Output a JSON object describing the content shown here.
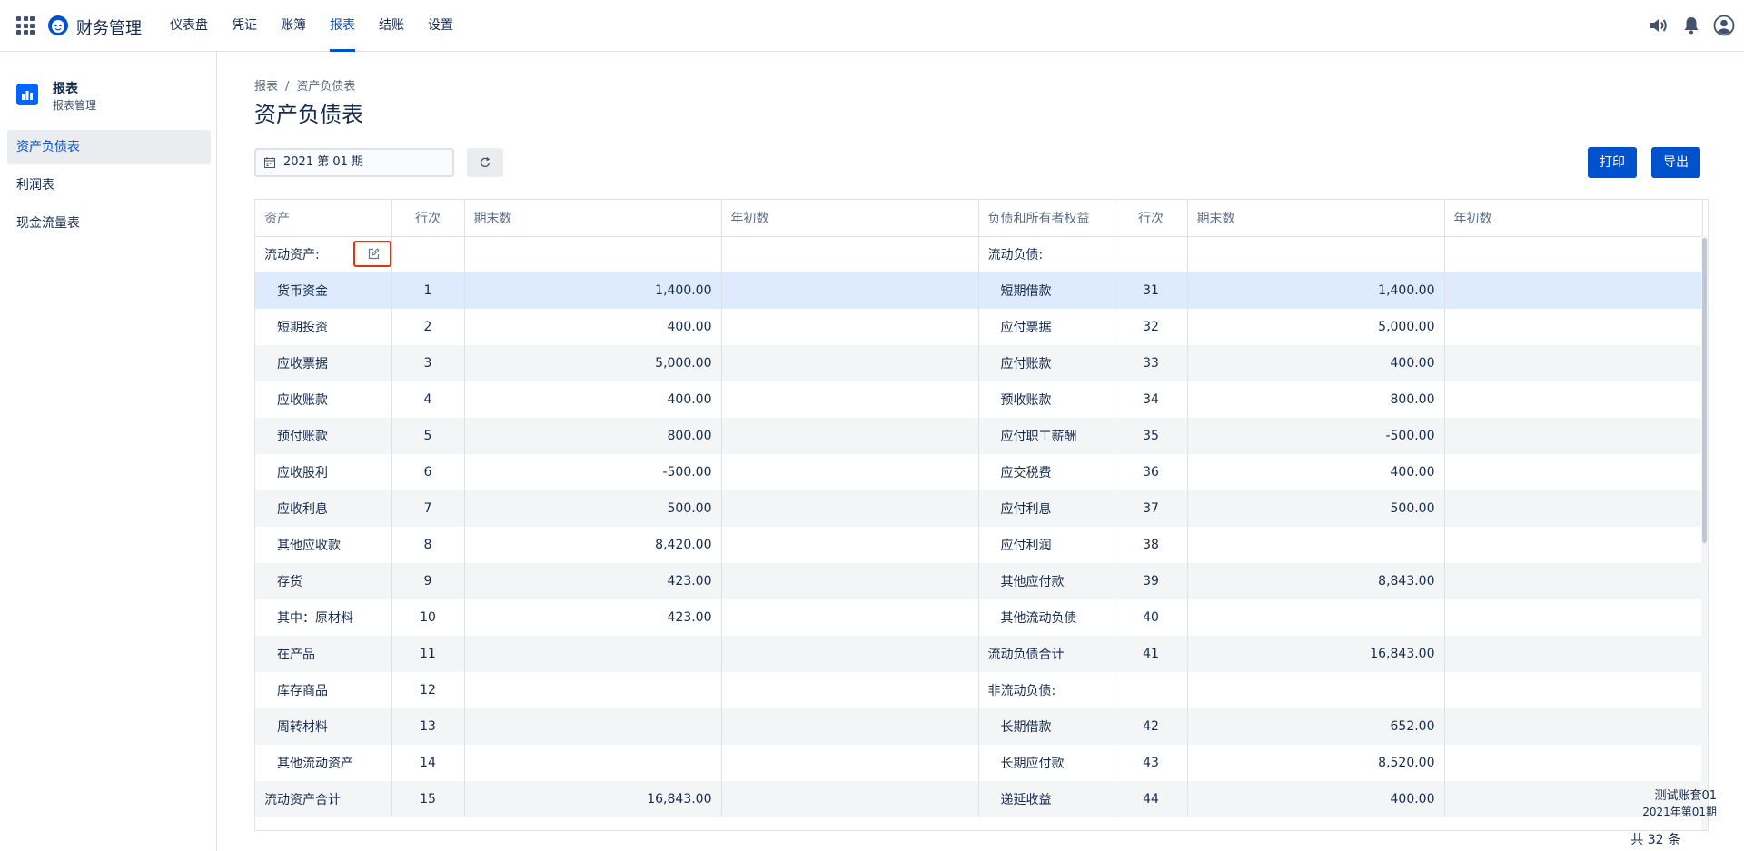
{
  "app": {
    "title": "财务管理"
  },
  "nav": {
    "items": [
      "仪表盘",
      "凭证",
      "账簿",
      "报表",
      "结账",
      "设置"
    ],
    "active_index": 3
  },
  "sidebar": {
    "title": "报表",
    "subtitle": "报表管理",
    "items": [
      "资产负债表",
      "利润表",
      "现金流量表"
    ],
    "active_index": 0
  },
  "breadcrumb": {
    "root": "报表",
    "separator": "/",
    "current": "资产负债表"
  },
  "page": {
    "title": "资产负债表"
  },
  "toolbar": {
    "period": "2021 第 01 期",
    "print_label": "打印",
    "export_label": "导出"
  },
  "table": {
    "headers": [
      "资产",
      "行次",
      "期末数",
      "年初数",
      "负债和所有者权益",
      "行次",
      "期末数",
      "年初数"
    ],
    "rows": [
      {
        "an": "流动资产:",
        "ar": "",
        "ae": "",
        "ab": "",
        "ln": "流动负债:",
        "lr": "",
        "le": "",
        "lb": "",
        "ai": false,
        "li": false
      },
      {
        "an": "货币资金",
        "ar": "1",
        "ae": "1,400.00",
        "ab": "",
        "ln": "短期借款",
        "lr": "31",
        "le": "1,400.00",
        "lb": "",
        "ai": true,
        "li": true
      },
      {
        "an": "短期投资",
        "ar": "2",
        "ae": "400.00",
        "ab": "",
        "ln": "应付票据",
        "lr": "32",
        "le": "5,000.00",
        "lb": "",
        "ai": true,
        "li": true
      },
      {
        "an": "应收票据",
        "ar": "3",
        "ae": "5,000.00",
        "ab": "",
        "ln": "应付账款",
        "lr": "33",
        "le": "400.00",
        "lb": "",
        "ai": true,
        "li": true
      },
      {
        "an": "应收账款",
        "ar": "4",
        "ae": "400.00",
        "ab": "",
        "ln": "预收账款",
        "lr": "34",
        "le": "800.00",
        "lb": "",
        "ai": true,
        "li": true
      },
      {
        "an": "预付账款",
        "ar": "5",
        "ae": "800.00",
        "ab": "",
        "ln": "应付职工薪酬",
        "lr": "35",
        "le": "-500.00",
        "lb": "",
        "ai": true,
        "li": true
      },
      {
        "an": "应收股利",
        "ar": "6",
        "ae": "-500.00",
        "ab": "",
        "ln": "应交税费",
        "lr": "36",
        "le": "400.00",
        "lb": "",
        "ai": true,
        "li": true
      },
      {
        "an": "应收利息",
        "ar": "7",
        "ae": "500.00",
        "ab": "",
        "ln": "应付利息",
        "lr": "37",
        "le": "500.00",
        "lb": "",
        "ai": true,
        "li": true
      },
      {
        "an": "其他应收款",
        "ar": "8",
        "ae": "8,420.00",
        "ab": "",
        "ln": "应付利润",
        "lr": "38",
        "le": "",
        "lb": "",
        "ai": true,
        "li": true
      },
      {
        "an": "存货",
        "ar": "9",
        "ae": "423.00",
        "ab": "",
        "ln": "其他应付款",
        "lr": "39",
        "le": "8,843.00",
        "lb": "",
        "ai": true,
        "li": true
      },
      {
        "an": "其中：原材料",
        "ar": "10",
        "ae": "423.00",
        "ab": "",
        "ln": "其他流动负债",
        "lr": "40",
        "le": "",
        "lb": "",
        "ai": true,
        "li": true
      },
      {
        "an": "在产品",
        "ar": "11",
        "ae": "",
        "ab": "",
        "ln": "流动负债合计",
        "lr": "41",
        "le": "16,843.00",
        "lb": "",
        "ai": true,
        "li": false
      },
      {
        "an": "库存商品",
        "ar": "12",
        "ae": "",
        "ab": "",
        "ln": "非流动负债:",
        "lr": "",
        "le": "",
        "lb": "",
        "ai": true,
        "li": false
      },
      {
        "an": "周转材料",
        "ar": "13",
        "ae": "",
        "ab": "",
        "ln": "长期借款",
        "lr": "42",
        "le": "652.00",
        "lb": "",
        "ai": true,
        "li": true
      },
      {
        "an": "其他流动资产",
        "ar": "14",
        "ae": "",
        "ab": "",
        "ln": "长期应付款",
        "lr": "43",
        "le": "8,520.00",
        "lb": "",
        "ai": true,
        "li": true
      },
      {
        "an": "流动资产合计",
        "ar": "15",
        "ae": "16,843.00",
        "ab": "",
        "ln": "递延收益",
        "lr": "44",
        "le": "400.00",
        "lb": "",
        "ai": false,
        "li": true
      }
    ],
    "highlight_row": 1
  },
  "footer": {
    "book": "测试账套01",
    "period": "2021年第01期",
    "total": "共 32 条"
  },
  "colors": {
    "primary": "#0052cc",
    "highlight_row": "#deebff",
    "edit_border": "#de350b"
  },
  "icons": [
    "apps-grid-icon",
    "logo-icon",
    "speaker-icon",
    "bell-icon",
    "user-avatar-icon",
    "reports-icon",
    "calendar-icon",
    "refresh-icon",
    "edit-icon"
  ]
}
